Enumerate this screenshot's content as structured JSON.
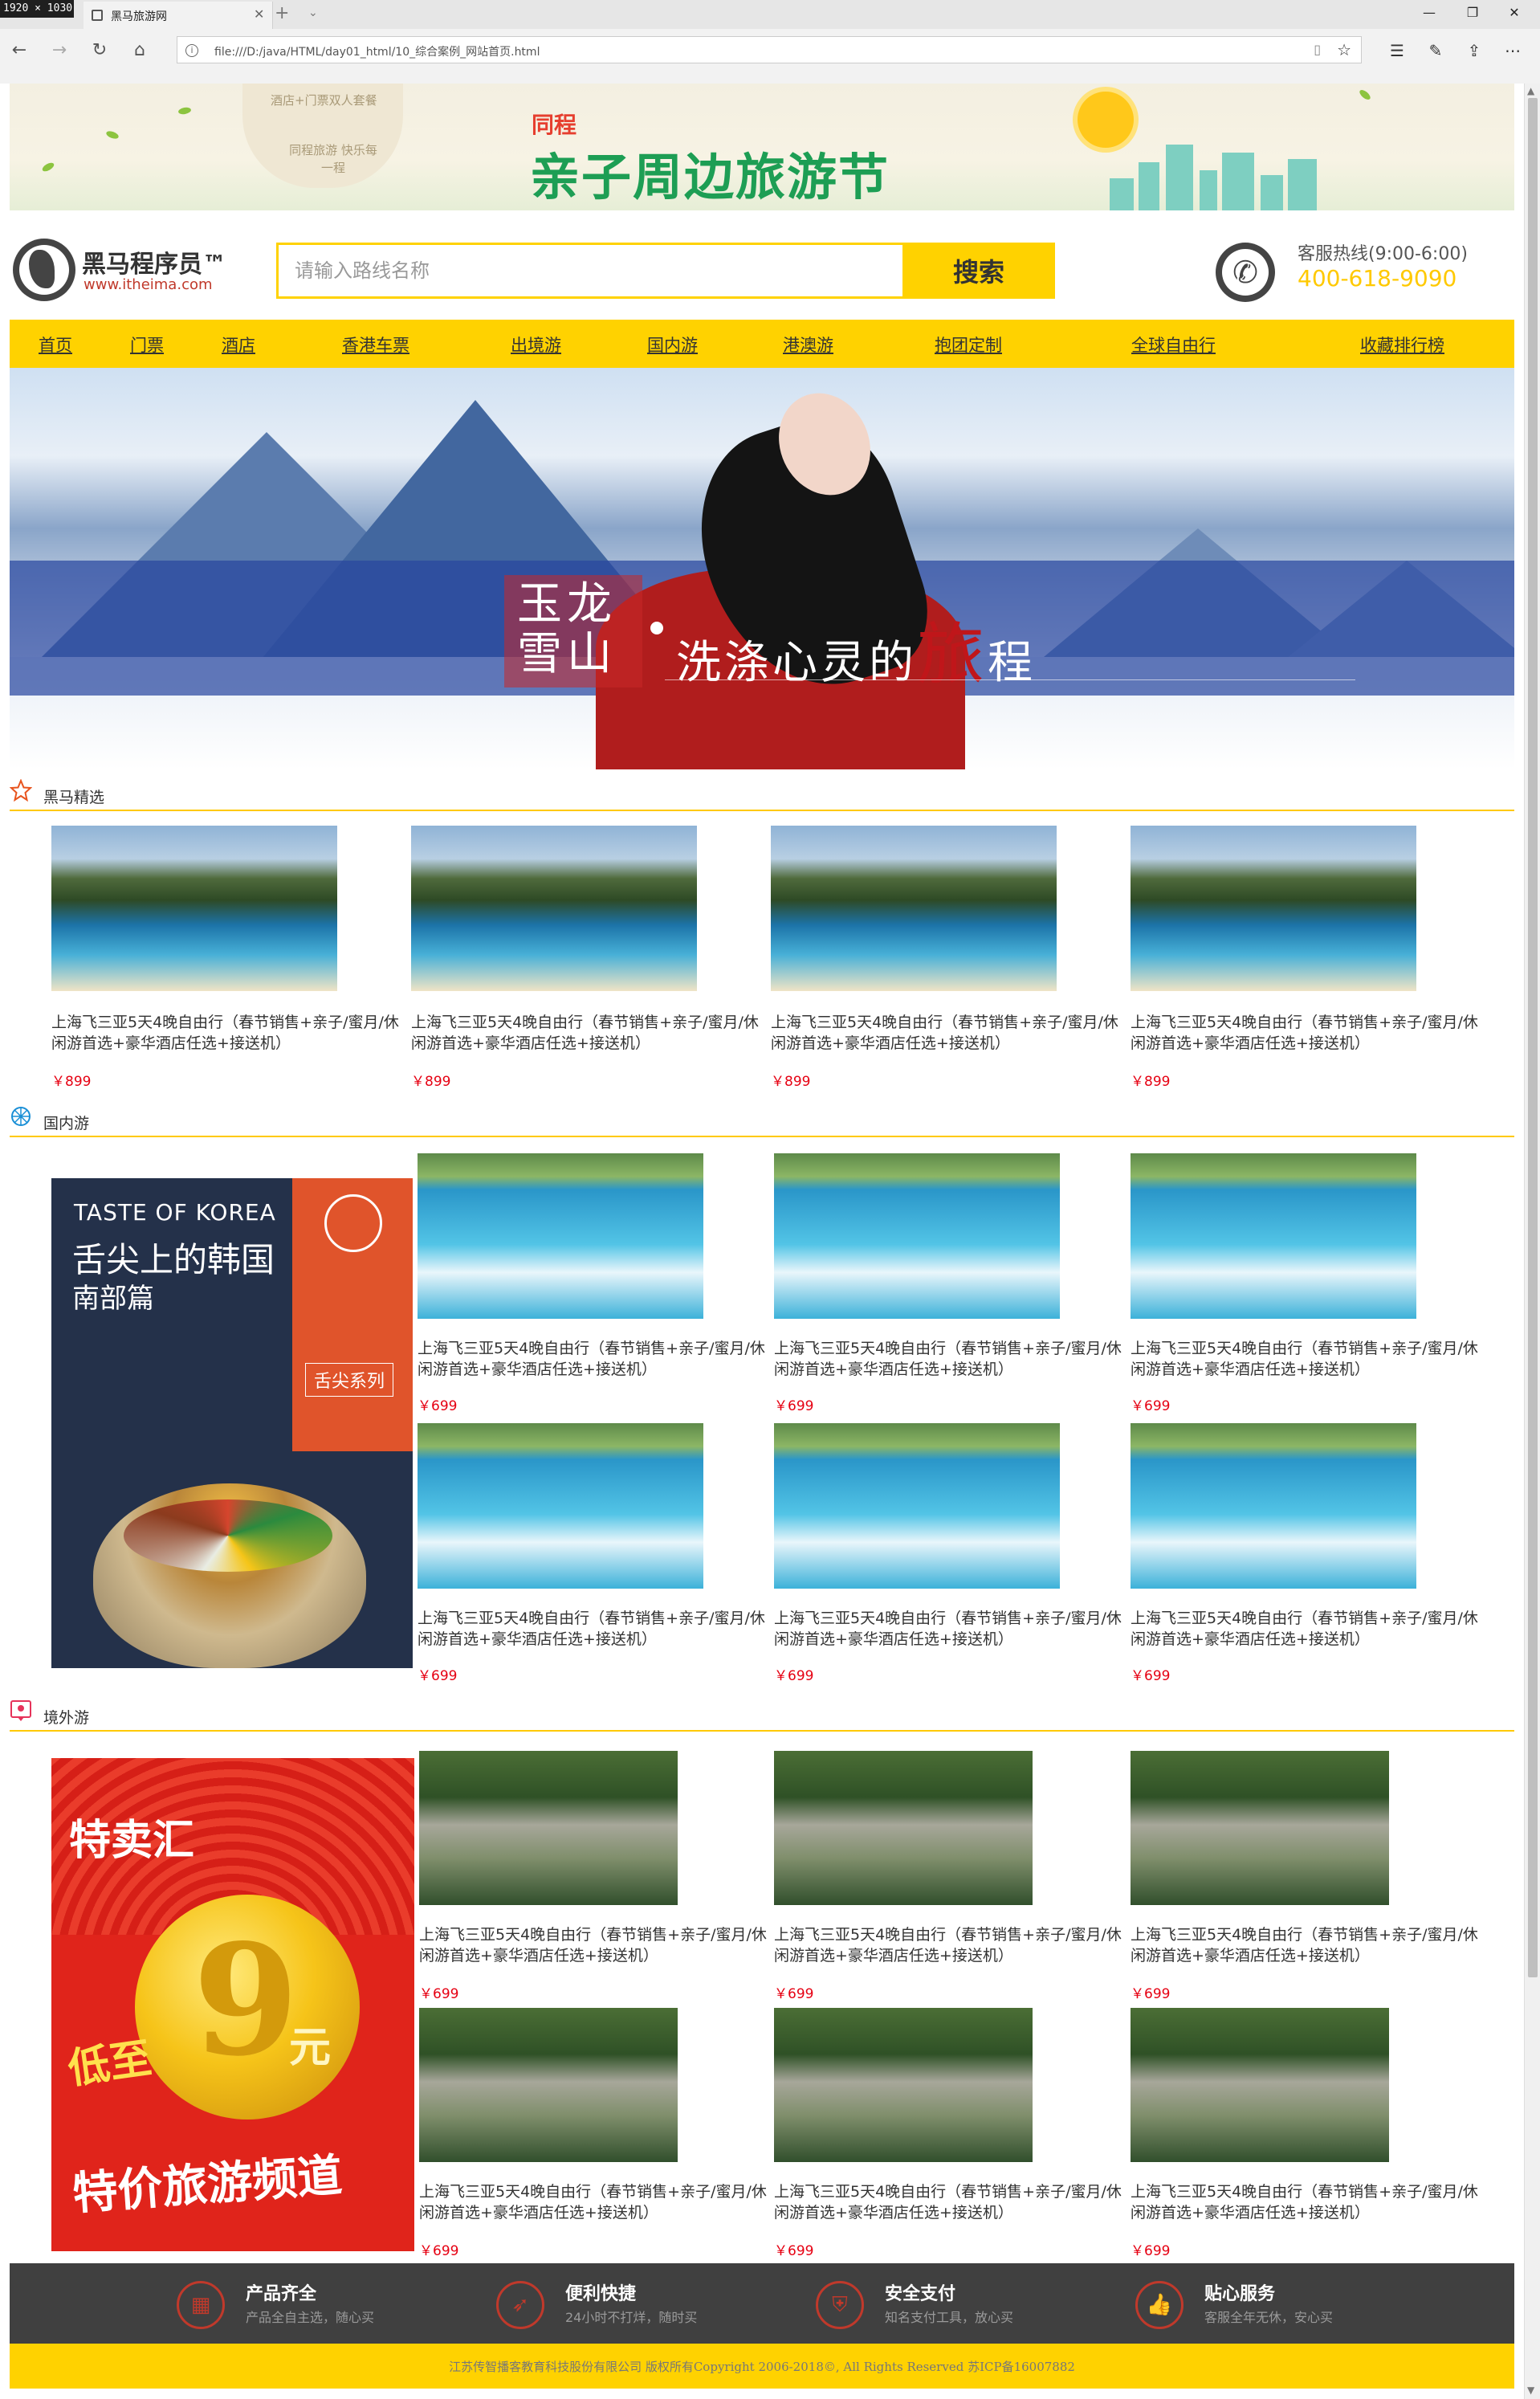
{
  "browser": {
    "dimensions_badge": "1920 × 1030",
    "tab_title": "黑马旅游网",
    "url": "file:///D:/java/HTML/day01_html/10_综合案例_网站首页.html"
  },
  "top_banner": {
    "cloud_line1": "酒店+门票双人套餐",
    "cloud_line2": "同程旅游 快乐每一程",
    "brand": "同程",
    "slogan": "亲子周边旅游节"
  },
  "header": {
    "logo_name": "黑马程序员™",
    "logo_url": "www.itheima.com",
    "search_placeholder": "请输入路线名称",
    "search_button": "搜索",
    "hotline_label": "客服热线(9:00-6:00)",
    "hotline_number": "400-618-9090"
  },
  "nav": {
    "items": [
      "首页",
      "门票",
      "酒店",
      "香港车票",
      "出境游",
      "国内游",
      "港澳游",
      "抱团定制",
      "全球自由行",
      "收藏排行榜"
    ]
  },
  "hero": {
    "seal_text": "玉龙雪山",
    "title_main": "洗涤心灵的",
    "title_accent": "旅",
    "title_end": "程"
  },
  "sections": {
    "featured": {
      "title": "黑马精选",
      "items": [
        {
          "title": "上海飞三亚5天4晚自由行（春节销售+亲子/蜜月/休闲游首选+豪华酒店任选+接送机）",
          "price": "￥899"
        },
        {
          "title": "上海飞三亚5天4晚自由行（春节销售+亲子/蜜月/休闲游首选+豪华酒店任选+接送机）",
          "price": "￥899"
        },
        {
          "title": "上海飞三亚5天4晚自由行（春节销售+亲子/蜜月/休闲游首选+豪华酒店任选+接送机）",
          "price": "￥899"
        },
        {
          "title": "上海飞三亚5天4晚自由行（春节销售+亲子/蜜月/休闲游首选+豪华酒店任选+接送机）",
          "price": "￥899"
        }
      ]
    },
    "domestic": {
      "title": "国内游",
      "ad": {
        "en": "TASTE OF KOREA",
        "cn1": "舌尖上的韩国",
        "cn2": "南部篇",
        "series": "舌尖系列"
      },
      "items": [
        {
          "title": "上海飞三亚5天4晚自由行（春节销售+亲子/蜜月/休闲游首选+豪华酒店任选+接送机）",
          "price": "￥699"
        },
        {
          "title": "上海飞三亚5天4晚自由行（春节销售+亲子/蜜月/休闲游首选+豪华酒店任选+接送机）",
          "price": "￥699"
        },
        {
          "title": "上海飞三亚5天4晚自由行（春节销售+亲子/蜜月/休闲游首选+豪华酒店任选+接送机）",
          "price": "￥699"
        },
        {
          "title": "上海飞三亚5天4晚自由行（春节销售+亲子/蜜月/休闲游首选+豪华酒店任选+接送机）",
          "price": "￥699"
        },
        {
          "title": "上海飞三亚5天4晚自由行（春节销售+亲子/蜜月/休闲游首选+豪华酒店任选+接送机）",
          "price": "￥699"
        },
        {
          "title": "上海飞三亚5天4晚自由行（春节销售+亲子/蜜月/休闲游首选+豪华酒店任选+接送机）",
          "price": "￥699"
        }
      ]
    },
    "overseas": {
      "title": "境外游",
      "ad": {
        "brand": "特卖汇",
        "low": "低至",
        "num": "9",
        "unit": "元",
        "channel": "特价旅游频道"
      },
      "items": [
        {
          "title": "上海飞三亚5天4晚自由行（春节销售+亲子/蜜月/休闲游首选+豪华酒店任选+接送机）",
          "price": "￥699"
        },
        {
          "title": "上海飞三亚5天4晚自由行（春节销售+亲子/蜜月/休闲游首选+豪华酒店任选+接送机）",
          "price": "￥699"
        },
        {
          "title": "上海飞三亚5天4晚自由行（春节销售+亲子/蜜月/休闲游首选+豪华酒店任选+接送机）",
          "price": "￥699"
        },
        {
          "title": "上海飞三亚5天4晚自由行（春节销售+亲子/蜜月/休闲游首选+豪华酒店任选+接送机）",
          "price": "￥699"
        },
        {
          "title": "上海飞三亚5天4晚自由行（春节销售+亲子/蜜月/休闲游首选+豪华酒店任选+接送机）",
          "price": "￥699"
        },
        {
          "title": "上海飞三亚5天4晚自由行（春节销售+亲子/蜜月/休闲游首选+豪华酒店任选+接送机）",
          "price": "￥699"
        }
      ]
    }
  },
  "features": [
    {
      "name": "产品齐全",
      "desc": "产品全自主选，随心买",
      "icon": "grid-icon"
    },
    {
      "name": "便利快捷",
      "desc": "24小时不打烊，随时买",
      "icon": "rocket-icon"
    },
    {
      "name": "安全支付",
      "desc": "知名支付工具，放心买",
      "icon": "shield-icon"
    },
    {
      "name": "贴心服务",
      "desc": "客服全年无休，安心买",
      "icon": "thumbs-up-icon"
    }
  ],
  "footer": {
    "copyright": "江苏传智播客教育科技股份有限公司 版权所有Copyright 2006-2018©, All Rights Reserved 苏ICP备16007882"
  },
  "colors": {
    "accent_yellow": "#ffd200",
    "price_red": "#e60012",
    "feature_bar": "#404040"
  }
}
